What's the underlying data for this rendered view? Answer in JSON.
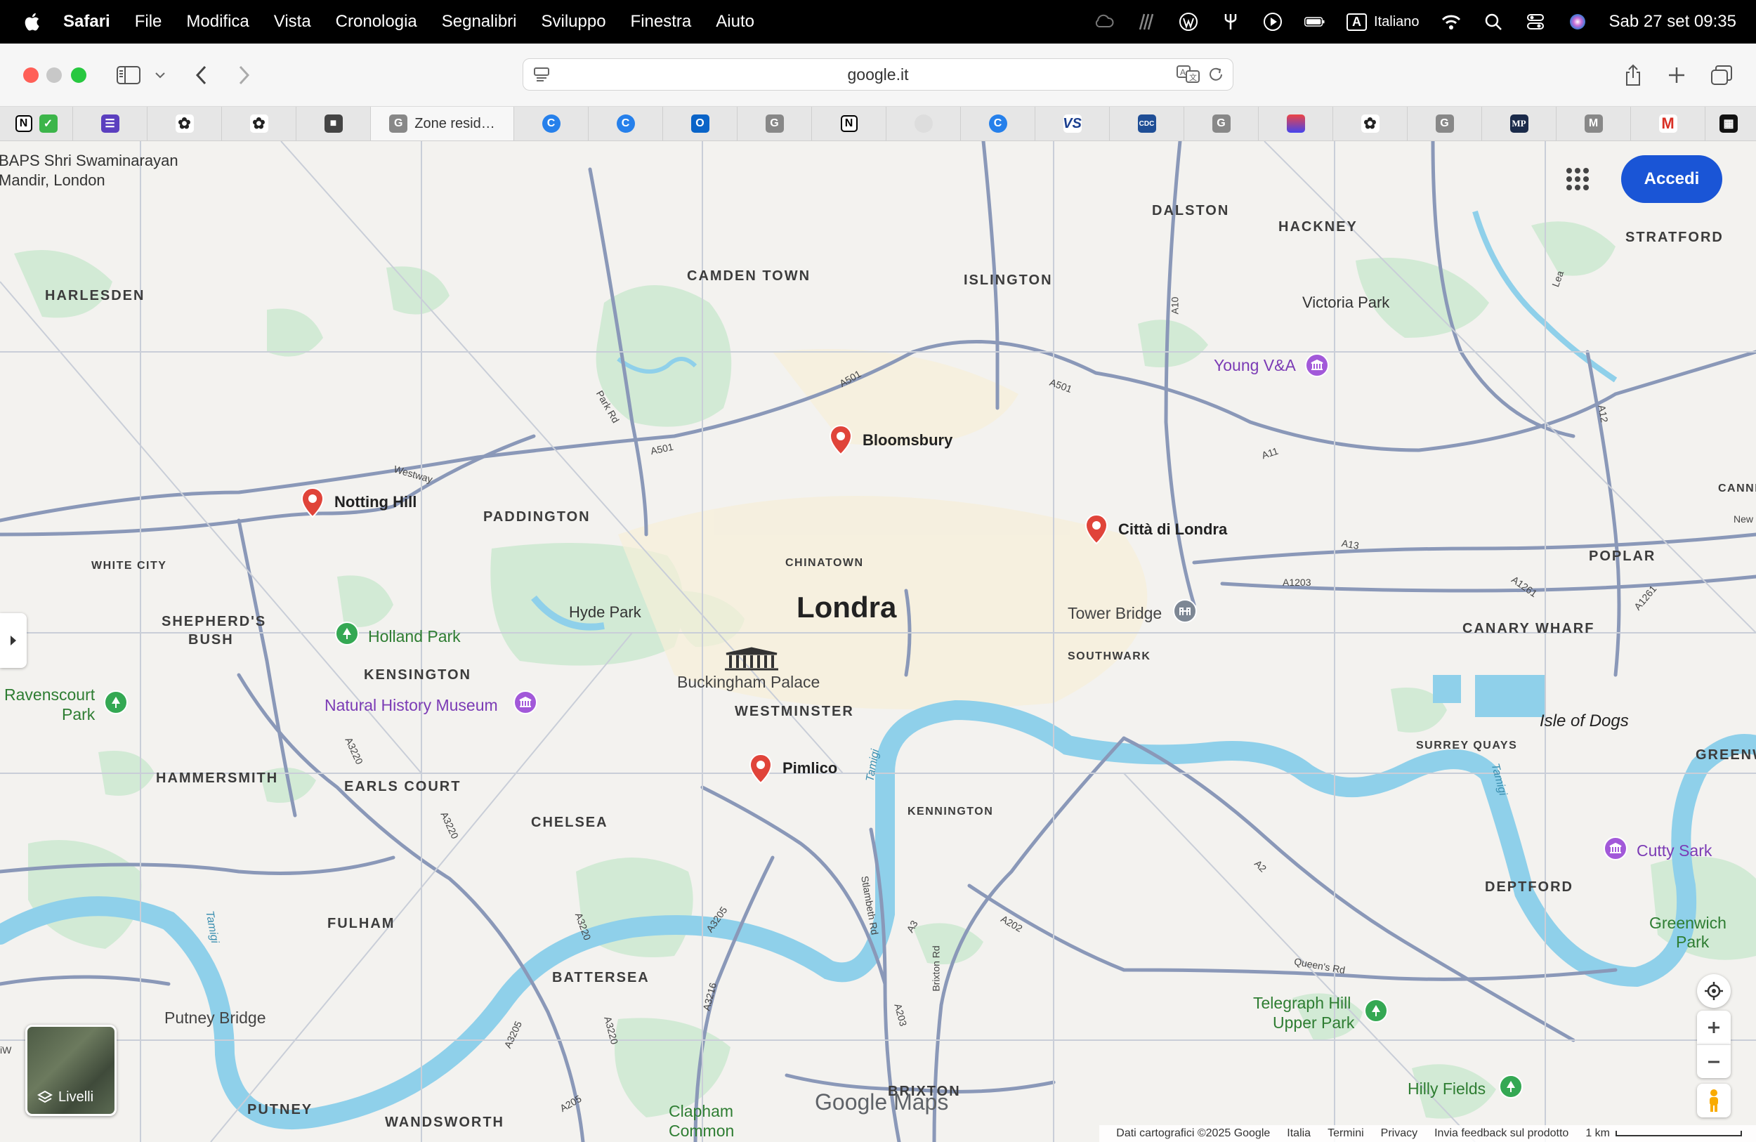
{
  "menubar": {
    "app_name": "Safari",
    "items": [
      "File",
      "Modifica",
      "Vista",
      "Cronologia",
      "Segnalibri",
      "Sviluppo",
      "Finestra",
      "Aiuto"
    ],
    "input_source": "Italiano",
    "datetime": "Sab 27 set  09:35"
  },
  "toolbar": {
    "url": "google.it"
  },
  "tabs": {
    "active_title": "Zone resid…"
  },
  "map": {
    "city": "Londra",
    "pins": [
      {
        "label": "Bloomsbury"
      },
      {
        "label": "Notting Hill"
      },
      {
        "label": "Città di Londra"
      },
      {
        "label": "Pimlico"
      }
    ],
    "districts": {
      "camden": "CAMDEN TOWN",
      "islington": "ISLINGTON",
      "dalston": "DALSTON",
      "hackney": "HACKNEY",
      "stratford": "STRATFORD",
      "harlesden": "HARLESDEN",
      "paddington": "PADDINGTON",
      "white_city": "WHITE CITY",
      "chinatown": "CHINATOWN",
      "poplar": "POPLAR",
      "shepherds": "SHEPHERD'S",
      "bush": "BUSH",
      "kensington": "KENSINGTON",
      "westminster": "WESTMINSTER",
      "southwark": "SOUTHWARK",
      "canary": "CANARY WHARF",
      "hammersmith": "HAMMERSMITH",
      "earls": "EARLS COURT",
      "chelsea": "CHELSEA",
      "kennington": "KENNINGTON",
      "surrey": "SURREY QUAYS",
      "deptford": "DEPTFORD",
      "fulham": "FULHAM",
      "battersea": "BATTERSEA",
      "brixton": "BRIXTON",
      "putney": "PUTNEY",
      "wandsworth": "WANDSWORTH",
      "canning": "CANNI",
      "greenwich_edge": "GREENW"
    },
    "places": {
      "baps_1": "BAPS Shri Swaminarayan",
      "baps_2": "Mandir, London",
      "victoria_park": "Victoria Park",
      "young_va": "Young V&A",
      "hyde_park": "Hyde Park",
      "tower_bridge": "Tower Bridge",
      "holland_park": "Holland Park",
      "buckingham": "Buckingham Palace",
      "nhm": "Natural History Museum",
      "ravenscourt_1": "Ravenscourt",
      "ravenscourt_2": "Park",
      "isle_of_dogs": "Isle of Dogs",
      "cutty_sark": "Cutty Sark",
      "greenwich_park_1": "Greenwich",
      "greenwich_park_2": "Park",
      "putney_bridge": "Putney Bridge",
      "telegraph_1": "Telegraph Hill",
      "telegraph_2": "Upper Park",
      "hilly_fields": "Hilly Fields",
      "clapham_1": "Clapham",
      "clapham_2": "Common",
      "new": "New"
    },
    "roads": {
      "a501a": "A501",
      "a501b": "A501",
      "a501c": "A501",
      "westway": "Westway",
      "parkrd": "Park Rd",
      "a10": "A10",
      "a11": "A11",
      "a12": "A12",
      "a13": "A13",
      "a1203": "A1203",
      "a1261a": "A1261",
      "a1261b": "A1261",
      "a3220a": "A3220",
      "a3220b": "A3220",
      "a3220c": "A3220",
      "a3220d": "A3220",
      "a3205a": "A3205",
      "a3205b": "A3205",
      "a3216": "A3216",
      "a3": "A3",
      "a202": "A202",
      "a2": "A2",
      "a203": "A203",
      "a205": "A205",
      "lambeth": "Stlambeth Rd",
      "brixton_rd": "Brixton Rd",
      "queens": "Queen's Rd",
      "lea": "Lea",
      "tamigi1": "Tamigi",
      "tamigi2": "Tamigi",
      "tamigi3": "Tamigi",
      "iw": "iW"
    },
    "accedi": "Accedi",
    "layers_label": "Livelli",
    "logo": "Google Maps",
    "footer": {
      "data": "Dati cartografici ©2025 Google",
      "country": "Italia",
      "terms": "Termini",
      "privacy": "Privacy",
      "feedback": "Invia feedback sul prodotto",
      "scale": "1 km"
    }
  },
  "colors": {
    "pin": "#e0443a",
    "accedi": "#1a55d6",
    "river": "#8fd0ea",
    "park": "#cfe9d3",
    "road": "#8a98b8"
  }
}
